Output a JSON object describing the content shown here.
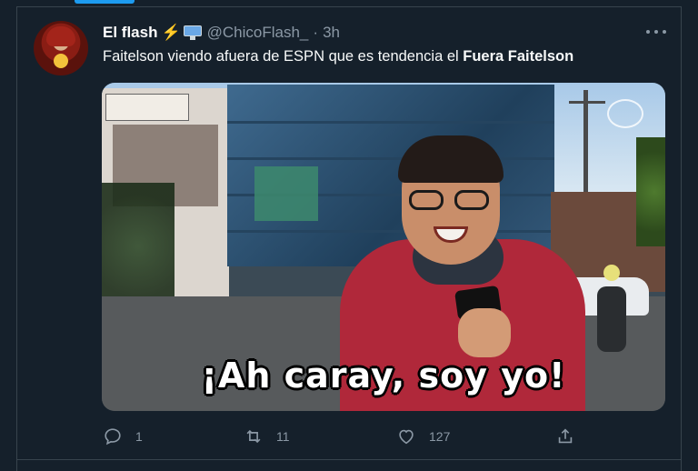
{
  "tweet": {
    "author_name": "El flash",
    "handle": "@ChicoFlash_",
    "separator": "·",
    "time": "3h",
    "text_before": "Faitelson viendo afuera de ESPN que es tendencia el ",
    "text_bold": "Fuera Faitelson",
    "name_emojis": [
      "lightning-bolt",
      "desktop-computer"
    ]
  },
  "media": {
    "caption": "¡Ah caray, soy yo!"
  },
  "actions": {
    "reply_count": "1",
    "retweet_count": "11",
    "like_count": "127"
  },
  "colors": {
    "background": "#15202b",
    "text": "#ffffff",
    "secondary": "#8b98a5",
    "accent": "#1d9bf0",
    "border": "#38444d"
  }
}
